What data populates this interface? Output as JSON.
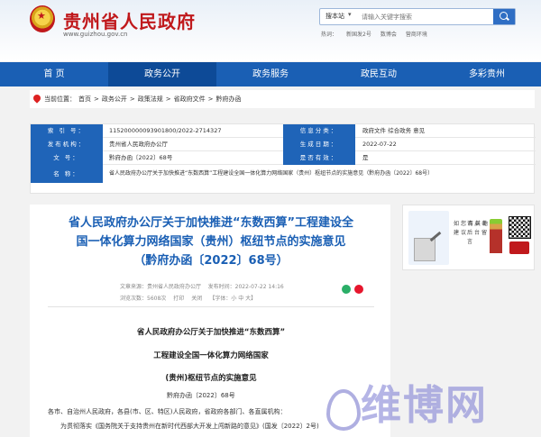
{
  "header": {
    "site_title": "贵州省人民政府",
    "site_url": "www.guizhou.gov.cn",
    "search_scope": "搜本站",
    "search_placeholder": "请输入关键字搜索",
    "hot_links": [
      "热词：",
      "新国发2号",
      "数博会",
      "营商环境"
    ]
  },
  "nav": {
    "items": [
      "首 页",
      "政务公开",
      "政务服务",
      "政民互动",
      "多彩贵州"
    ],
    "active_index": 1,
    "color": "#1a5fb4"
  },
  "breadcrumb": {
    "label": "当前位置：",
    "items": [
      "首页",
      "政务公开",
      "政策法规",
      "省政府文件",
      "黔府办函"
    ],
    "separator": ">"
  },
  "info": {
    "index_label": "索 引 号：",
    "index_value": "115200000093901800/2022-2714327",
    "category_label": "信息分类：",
    "category_value": "政府文件  综合政务  意见",
    "agency_label": "发布机构：",
    "agency_value": "贵州省人民政府办公厅",
    "date_label": "生成日期：",
    "date_value": "2022-07-22",
    "docno_label": "文  号：",
    "docno_value": "黔府办函〔2022〕68号",
    "valid_label": "是否有效：",
    "valid_value": "是",
    "name_label": "名  称：",
    "name_value": "省人民政府办公厅关于加快推进“东数西算”工程建设全国一体化算力网络国家（贵州）枢纽节点的实施意见（黔府办函〔2022〕68号）"
  },
  "article": {
    "title_line1": "省人民政府办公厅关于加快推进“东数西算”工程建设全",
    "title_line2": "国一体化算力网络国家（贵州）枢纽节点的实施意见",
    "title_line3": "（黔府办函〔2022〕68号）",
    "source": "文章来源：贵州省人民政府办公厅",
    "publish_time": "发布时间：2022-07-22 14:16",
    "views": "浏览次数：5608次",
    "print": "打印",
    "close": "关闭",
    "font_size": "【字体：小 中 大】",
    "body_title_1": "省人民政府办公厅关于加快推进“东数西算”",
    "body_title_2": "工程建设全国一体化算力网络国家",
    "body_title_3": "(贵州)枢纽节点的实施意见",
    "doc_number": "黔府办函〔2022〕68号",
    "para1": "各市、自治州人民政府，各县(市、区、特区)人民政府，省政府各部门、各直属机构：",
    "para2": "为贯彻落实《国务院关于支持贵州在新时代西部大开发上闯新路的意见》(国发〔2022〕2号)"
  },
  "sidebar": {
    "text_left": "如您有其他建议",
    "text_right": "请点击后台留言"
  },
  "watermark": {
    "text": "维博网"
  }
}
